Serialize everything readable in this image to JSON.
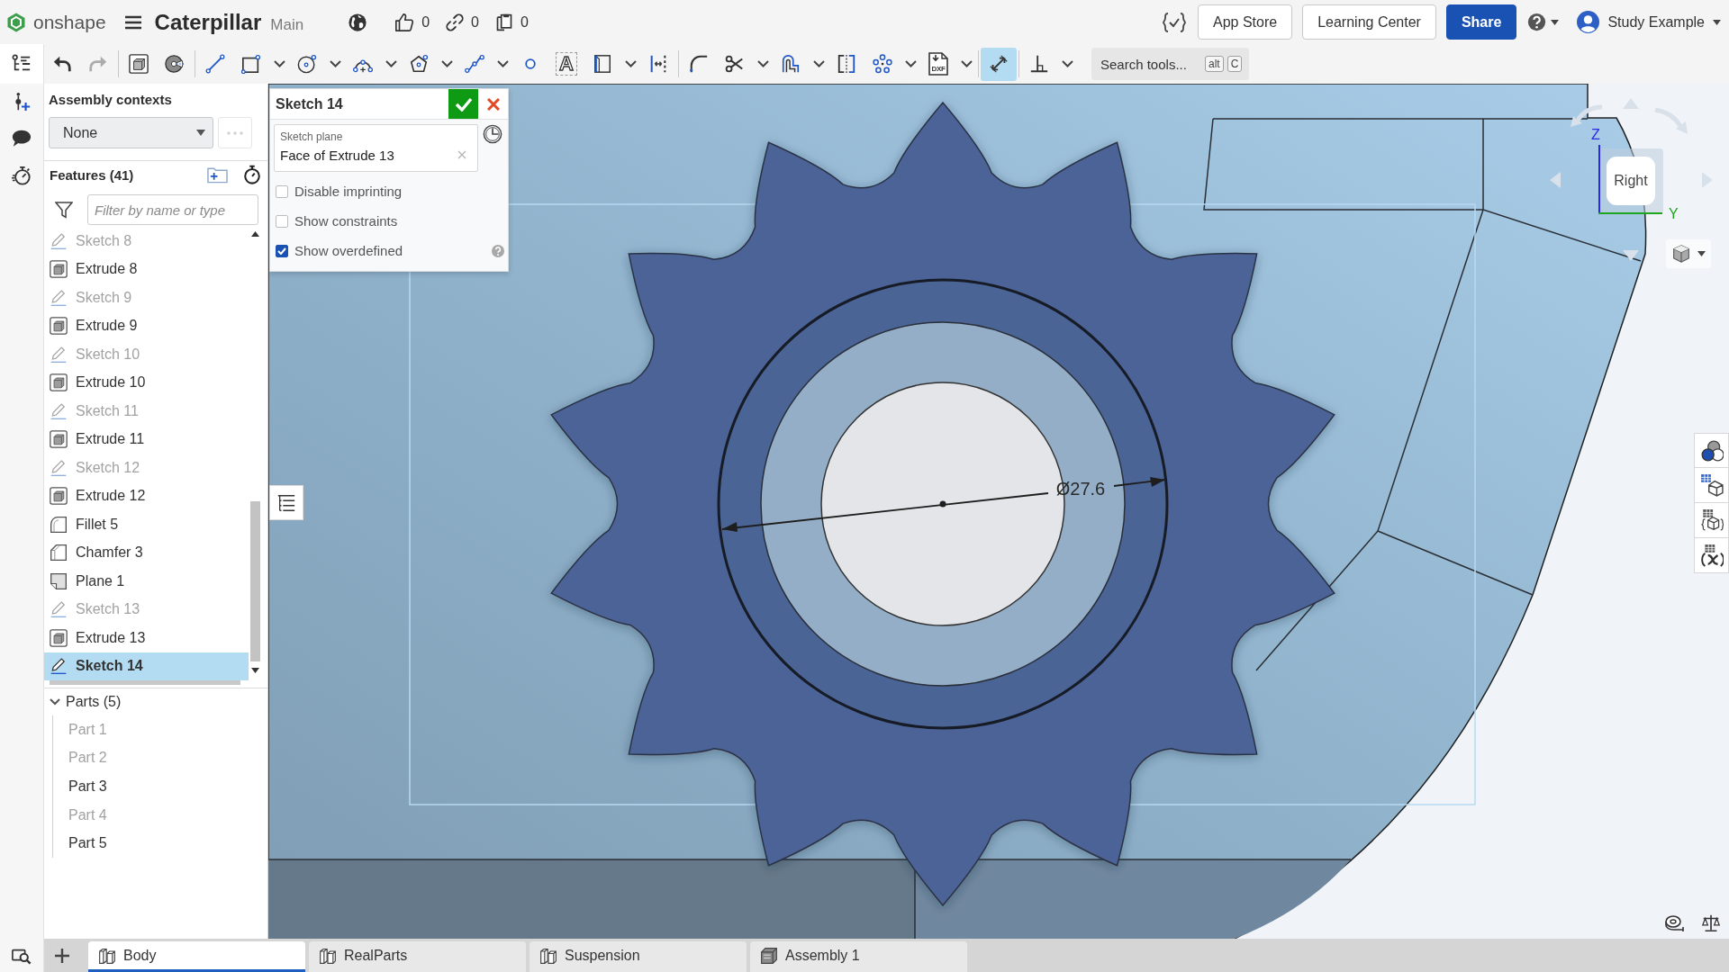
{
  "header": {
    "logo": "onshape",
    "title": "Caterpillar",
    "workspace": "Main",
    "counters": [
      {
        "kind": "likes",
        "value": "0"
      },
      {
        "kind": "links",
        "value": "0"
      },
      {
        "kind": "copies",
        "value": "0"
      }
    ],
    "buttons": [
      {
        "label": "App Store",
        "kind": "secondary"
      },
      {
        "label": "Learning Center",
        "kind": "secondary"
      },
      {
        "label": "Share",
        "kind": "primary"
      }
    ],
    "user": "Study Example"
  },
  "toolbar": {
    "groups": [
      [
        {
          "selected": false,
          "disabled": false,
          "menu": false
        },
        {
          "selected": false,
          "disabled": true,
          "menu": false
        }
      ],
      [
        {
          "selected": false,
          "disabled": false,
          "menu": false
        },
        {
          "selected": false,
          "disabled": false,
          "menu": false
        }
      ],
      [
        {
          "selected": false,
          "disabled": false,
          "menu": false
        },
        {
          "selected": false,
          "disabled": false,
          "menu": true
        },
        {
          "selected": false,
          "disabled": false,
          "menu": true
        },
        {
          "selected": false,
          "disabled": false,
          "menu": true
        },
        {
          "selected": false,
          "disabled": false,
          "menu": true
        },
        {
          "selected": false,
          "disabled": false,
          "menu": true
        },
        {
          "selected": false,
          "disabled": false,
          "menu": false
        },
        {
          "selected": false,
          "disabled": false,
          "menu": false,
          "glyph": "A"
        },
        {
          "selected": false,
          "disabled": false,
          "menu": true
        },
        {
          "selected": false,
          "disabled": false,
          "menu": false
        }
      ],
      [
        {
          "selected": false,
          "disabled": false,
          "menu": false
        },
        {
          "selected": false,
          "disabled": false,
          "menu": true
        },
        {
          "selected": false,
          "disabled": false,
          "menu": true
        },
        {
          "selected": false,
          "disabled": false,
          "menu": false
        },
        {
          "selected": false,
          "disabled": false,
          "menu": true
        },
        {
          "selected": false,
          "disabled": false,
          "menu": true,
          "glyph": "DXF"
        }
      ],
      [
        {
          "selected": true,
          "disabled": false,
          "menu": false
        }
      ],
      [
        {
          "selected": false,
          "disabled": false,
          "menu": true
        }
      ]
    ],
    "search": {
      "placeholder": "Search tools...",
      "keys": [
        "alt",
        "C"
      ]
    }
  },
  "assembly_contexts": {
    "title": "Assembly contexts",
    "value": "None"
  },
  "features": {
    "title": "Features (41)",
    "filter_placeholder": "Filter by name or type",
    "items": [
      {
        "name": "Sketch 8",
        "kind": "sketch",
        "hidden": true,
        "selected": false
      },
      {
        "name": "Extrude 8",
        "kind": "extrude",
        "hidden": false,
        "selected": false
      },
      {
        "name": "Sketch 9",
        "kind": "sketch",
        "hidden": true,
        "selected": false
      },
      {
        "name": "Extrude 9",
        "kind": "extrude",
        "hidden": false,
        "selected": false
      },
      {
        "name": "Sketch 10",
        "kind": "sketch",
        "hidden": true,
        "selected": false
      },
      {
        "name": "Extrude 10",
        "kind": "extrude",
        "hidden": false,
        "selected": false
      },
      {
        "name": "Sketch 11",
        "kind": "sketch",
        "hidden": true,
        "selected": false
      },
      {
        "name": "Extrude 11",
        "kind": "extrude",
        "hidden": false,
        "selected": false
      },
      {
        "name": "Sketch 12",
        "kind": "sketch",
        "hidden": true,
        "selected": false
      },
      {
        "name": "Extrude 12",
        "kind": "extrude",
        "hidden": false,
        "selected": false
      },
      {
        "name": "Fillet 5",
        "kind": "fillet",
        "hidden": false,
        "selected": false
      },
      {
        "name": "Chamfer 3",
        "kind": "chamfer",
        "hidden": false,
        "selected": false
      },
      {
        "name": "Plane 1",
        "kind": "plane",
        "hidden": false,
        "selected": false
      },
      {
        "name": "Sketch 13",
        "kind": "sketch",
        "hidden": true,
        "selected": false
      },
      {
        "name": "Extrude 13",
        "kind": "extrude",
        "hidden": false,
        "selected": false
      },
      {
        "name": "Sketch 14",
        "kind": "sketch",
        "hidden": false,
        "selected": true
      }
    ]
  },
  "parts": {
    "title": "Parts (5)",
    "expanded": true,
    "items": [
      {
        "name": "Part 1",
        "hidden": true
      },
      {
        "name": "Part 2",
        "hidden": true
      },
      {
        "name": "Part 3",
        "hidden": false
      },
      {
        "name": "Part 4",
        "hidden": true
      },
      {
        "name": "Part 5",
        "hidden": false
      }
    ]
  },
  "sketch_dialog": {
    "title": "Sketch 14",
    "plane": {
      "label": "Sketch plane",
      "value": "Face of Extrude 13"
    },
    "options": [
      {
        "label": "Disable imprinting",
        "checked": false
      },
      {
        "label": "Show constraints",
        "checked": false
      },
      {
        "label": "Show overdefined",
        "checked": true
      }
    ]
  },
  "viewport": {
    "dimension": "Ø27.6",
    "view_cube": {
      "face": "Right",
      "axes": [
        {
          "label": "Z",
          "color": "#2a2ae6"
        },
        {
          "label": "Y",
          "color": "#1fa61f"
        }
      ]
    }
  },
  "tabs": [
    {
      "label": "Body",
      "kind": "part_studio",
      "selected": true
    },
    {
      "label": "RealParts",
      "kind": "part_studio",
      "selected": false
    },
    {
      "label": "Suspension",
      "kind": "part_studio",
      "selected": false
    },
    {
      "label": "Assembly 1",
      "kind": "assembly",
      "selected": false
    }
  ]
}
